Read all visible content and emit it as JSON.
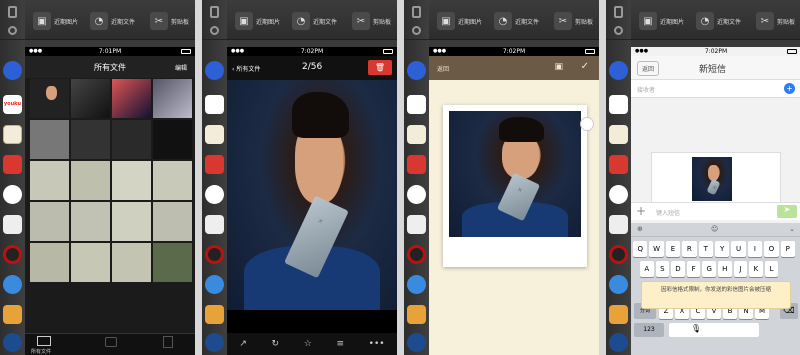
{
  "toolbar": {
    "recent_images": "近期图片",
    "recent_files": "近期文件",
    "clipboard": "剪贴板"
  },
  "panel1": {
    "time": "7:01PM",
    "title": "所有文件",
    "edit": "编辑",
    "bottom_tab": "所有文件"
  },
  "panel2": {
    "time": "7:02PM",
    "back": "所有文件",
    "counter": "2/56"
  },
  "panel3": {
    "time": "7:02PM",
    "back": "返回"
  },
  "panel4": {
    "time": "7:02PM",
    "back": "返回",
    "title": "新短信",
    "to_placeholder": "接收者",
    "message_placeholder": "键入短信",
    "toast": "因彩信格式限制，你发送的彩信图片会被压缩",
    "key_switch": "分词",
    "key_123": "123",
    "keyboard": {
      "row1": [
        "Q",
        "W",
        "E",
        "R",
        "T",
        "Y",
        "U",
        "I",
        "O",
        "P"
      ],
      "row2": [
        "A",
        "S",
        "D",
        "F",
        "G",
        "H",
        "J",
        "K",
        "L"
      ],
      "row3": [
        "Z",
        "X",
        "C",
        "V",
        "B",
        "N",
        "M"
      ]
    }
  },
  "colors": {
    "delete_red": "#d8382f",
    "ios_blue": "#2e7cf6",
    "send_green": "#b9e39a"
  }
}
